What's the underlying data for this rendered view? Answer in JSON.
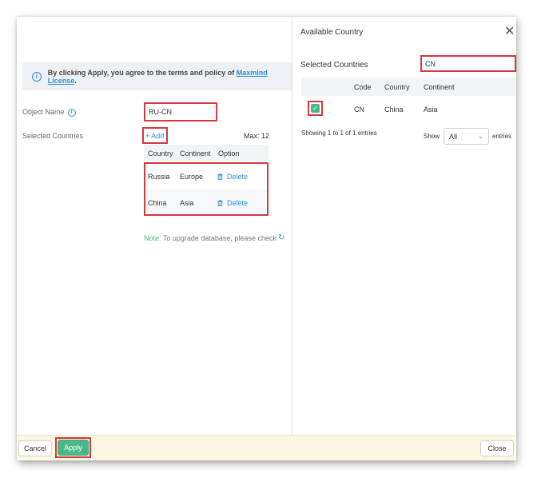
{
  "notice": {
    "text": "By clicking Apply, you agree to the terms and policy of ",
    "link": "Maxmind License",
    "suffix": "."
  },
  "form": {
    "object_name_label": "Object Name",
    "object_name_value": "RU-CN",
    "selected_countries_label": "Selected Countries",
    "add_label": "+ Add",
    "max_label": "Max: 12"
  },
  "table": {
    "headers": [
      "Country",
      "Continent",
      "Option"
    ],
    "rows": [
      {
        "country": "Russia",
        "continent": "Europe",
        "option": "Delete"
      },
      {
        "country": "China",
        "continent": "Asia",
        "option": "Delete"
      }
    ]
  },
  "note": {
    "prefix": "Note:",
    "text": " To upgrade database, please check"
  },
  "footer": {
    "cancel_label": "Cancel",
    "apply_label": "Apply",
    "close_label": "Close"
  },
  "available": {
    "title": "Available Country",
    "search_label": "Selected Countries",
    "search_value": "CN",
    "headers": [
      "Code",
      "Country",
      "Continent"
    ],
    "rows": [
      {
        "checked": true,
        "code": "CN",
        "country": "China",
        "continent": "Asia"
      }
    ],
    "showing_text": "Showing 1 to 1 of 1 entries",
    "show_label": "Show",
    "show_value": "All",
    "entries_label": "entries"
  },
  "colors": {
    "accent": "#2a8fd6",
    "primary_button": "#4cb88a",
    "highlight_border": "#d9363e",
    "footer_bg": "#fdf8e4"
  }
}
